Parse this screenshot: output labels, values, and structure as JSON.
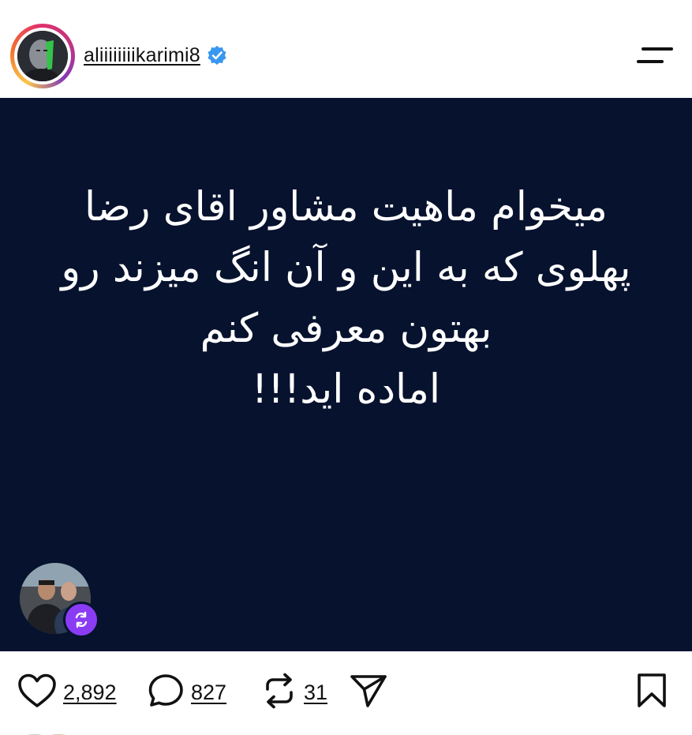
{
  "header": {
    "username": "aliiiiiiiikarimi8",
    "verified_icon": "verified-badge-icon",
    "menu_icon": "menu-icon"
  },
  "post": {
    "background_color": "#06122e",
    "text_lines": [
      "میخوام ماهیت مشاور اقای رضا",
      "پهلوی که به این و آن انگ میزند رو",
      "بهتون معرفی کنم",
      "اماده اید!!!"
    ],
    "repost_badge_color": "#8a3cf5"
  },
  "actions": {
    "likes": "2,892",
    "comments": "827",
    "reposts": "31"
  }
}
